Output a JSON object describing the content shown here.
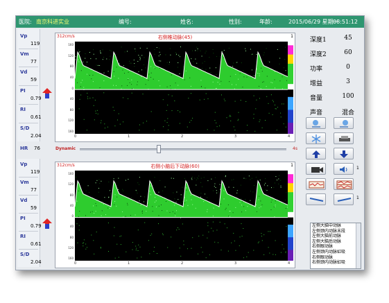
{
  "header": {
    "hospital_label": "医院:",
    "hospital_value": "南京科进实业",
    "number_label": "编号:",
    "name_label": "姓名:",
    "sex_label": "性别:",
    "age_label": "年龄:",
    "datetime": "2015/06/29 星期一",
    "time": "08:51:12"
  },
  "top_metrics": [
    {
      "label": "Vp",
      "value": "119"
    },
    {
      "label": "Vm",
      "value": "77"
    },
    {
      "label": "Vd",
      "value": "59"
    },
    {
      "label": "PI",
      "value": "0.79"
    },
    {
      "label": "RI",
      "value": "0.61"
    },
    {
      "label": "S/D",
      "value": "2.04"
    }
  ],
  "bottom_metrics": [
    {
      "label": "Vp",
      "value": "119"
    },
    {
      "label": "Vm",
      "value": "77"
    },
    {
      "label": "Vd",
      "value": "59"
    },
    {
      "label": "PI",
      "value": "0.79"
    },
    {
      "label": "RI",
      "value": "0.61"
    },
    {
      "label": "S/D",
      "value": "2.04"
    }
  ],
  "hr": {
    "label": "HR",
    "value": "76"
  },
  "slider": {
    "label": "Dynamic",
    "end_label": "4s",
    "level_fraction": 0.38
  },
  "graph_top": {
    "scale": "312cm/s",
    "title": "右侧椎动脉(45)",
    "channel": "1"
  },
  "graph_bottom": {
    "scale": "312cm/s",
    "title": "右侧小脑后下动脉(60)",
    "channel": "1"
  },
  "y_ticks": [
    "160",
    "120",
    "80",
    "40",
    "0",
    "40",
    "80",
    "120",
    "160"
  ],
  "x_ticks": [
    "0",
    "1",
    "2",
    "3",
    "4"
  ],
  "right_panel": [
    {
      "key": "深度1",
      "value": "45"
    },
    {
      "key": "深度2",
      "value": "60"
    },
    {
      "key": "功率",
      "value": "0"
    },
    {
      "key": "增益",
      "value": "3"
    },
    {
      "key": "音量",
      "value": "100"
    },
    {
      "key": "声音",
      "value": "混合"
    }
  ],
  "buttons_side_labels": {
    "speaker": "1",
    "probe": "1"
  },
  "vessel_list": [
    "左侧大脑中动脉",
    "左侧颈内动脉末段",
    "左侧大脑前动脉",
    "左侧大脑后动脉",
    "右侧眼动脉",
    "左侧颈内动脉虹吸",
    "右侧眼动脉",
    "右侧颈内动脉虹吸"
  ],
  "colors": {
    "title_bg": "#2f9670",
    "waveform": "#2ecc2e",
    "envelope": "#ffffff",
    "label_blue": "#2d3a9b",
    "title_red": "#d32020"
  }
}
